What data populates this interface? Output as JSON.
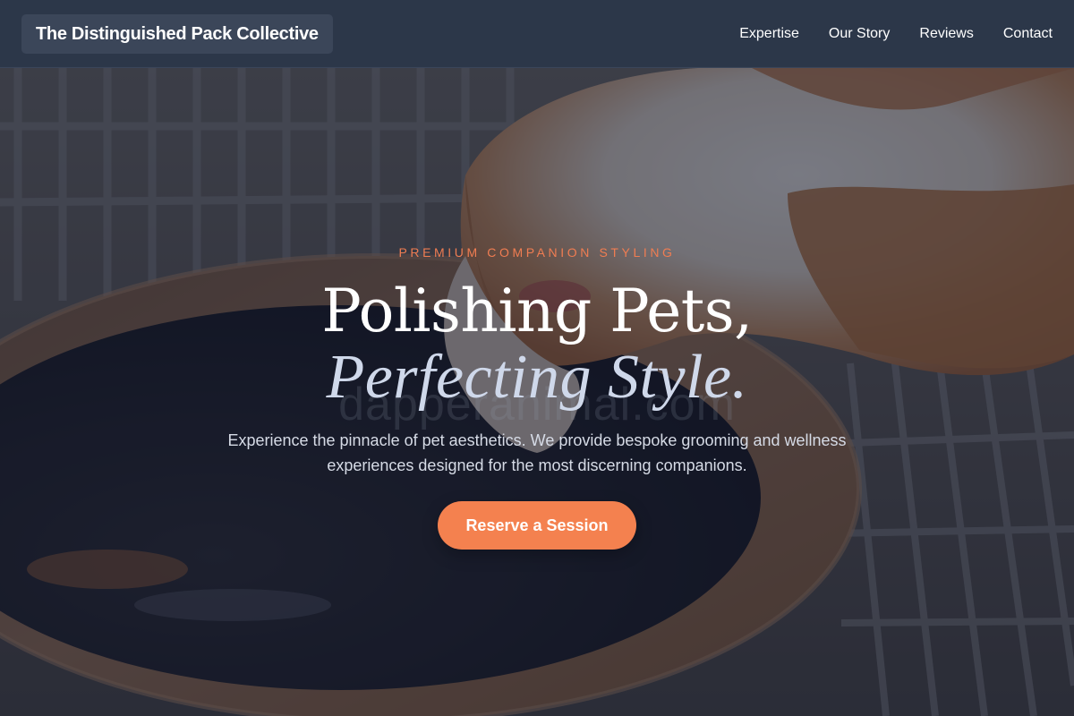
{
  "header": {
    "brand": "The Distinguished Pack Collective",
    "nav": [
      {
        "label": "Expertise"
      },
      {
        "label": "Our Story"
      },
      {
        "label": "Reviews"
      },
      {
        "label": "Contact"
      }
    ]
  },
  "hero": {
    "eyebrow": "PREMIUM COMPANION STYLING",
    "headline_line1": "Polishing Pets,",
    "headline_line2": "Perfecting Style.",
    "watermark": "dapperanimal.com",
    "lede": "Experience the pinnacle of pet aesthetics. We provide bespoke grooming and wellness experiences designed for the most discerning companions.",
    "cta_label": "Reserve a Session",
    "background_image": "guinea-pig-drinking-from-clay-bowl-photo"
  },
  "colors": {
    "header_bg": "#2c3749",
    "brand_chip_bg": "#3b4659",
    "accent": "#f4814f",
    "eyebrow": "#f07d52",
    "headline_italic": "#cfd8ea"
  }
}
